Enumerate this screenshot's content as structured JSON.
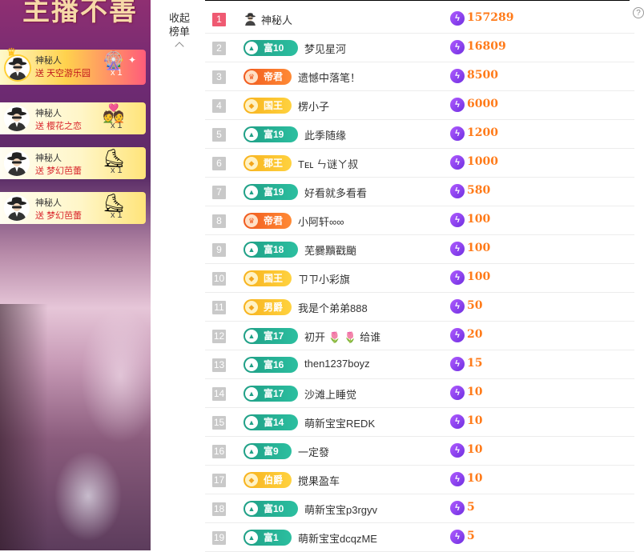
{
  "stream": {
    "title": "主播不善",
    "gifts": [
      {
        "name": "神秘人",
        "send_word": "送",
        "gift": "天空游乐园",
        "count": "x 1",
        "top": true
      },
      {
        "name": "神秘人",
        "send_word": "送",
        "gift": "樱花之恋",
        "count": "x 1",
        "top": false
      },
      {
        "name": "神秘人",
        "send_word": "送",
        "gift": "梦幻芭蕾",
        "count": "x 1",
        "top": false
      },
      {
        "name": "神秘人",
        "send_word": "送",
        "gift": "梦幻芭蕾",
        "count": "x 1",
        "top": false
      }
    ]
  },
  "collapse": {
    "line1": "收起",
    "line2": "榜单"
  },
  "help_icon": "?",
  "colors": {
    "accent": "#ff7b1a",
    "first_rank": "#ef5a72",
    "fu": "#1f9f86",
    "wang": "#f7b21e",
    "dijun": "#f05a1e",
    "coin": "#8a3ff0"
  },
  "ranking": [
    {
      "rank": "1",
      "badge": null,
      "badge_type": null,
      "name": "神秘人",
      "score": "157289"
    },
    {
      "rank": "2",
      "badge": "富10",
      "badge_type": "fu",
      "name": "梦见星河",
      "score": "16809"
    },
    {
      "rank": "3",
      "badge": "帝君",
      "badge_type": "dijun",
      "name": "遗憾中落笔！",
      "score": "8500"
    },
    {
      "rank": "4",
      "badge": "国王",
      "badge_type": "wang",
      "name": "楞小子",
      "score": "6000"
    },
    {
      "rank": "5",
      "badge": "富19",
      "badge_type": "fu",
      "name": "此季随缘",
      "score": "1200"
    },
    {
      "rank": "6",
      "badge": "郡王",
      "badge_type": "wang",
      "name": "Tᴇʟ ㄣ谜ㄚ叔",
      "score": "1000"
    },
    {
      "rank": "7",
      "badge": "富19",
      "badge_type": "fu",
      "name": "好看就多看看",
      "score": "580"
    },
    {
      "rank": "8",
      "badge": "帝君",
      "badge_type": "dijun",
      "name": "小阿轩∞∞",
      "score": "100"
    },
    {
      "rank": "9",
      "badge": "富18",
      "badge_type": "fu",
      "name": "芜爨黷戳颵",
      "score": "100"
    },
    {
      "rank": "10",
      "badge": "国王",
      "badge_type": "wang",
      "name": "ㄗㄗ小彩旗",
      "score": "100"
    },
    {
      "rank": "11",
      "badge": "男爵",
      "badge_type": "wang",
      "name": "我是个弟弟888",
      "score": "50"
    },
    {
      "rank": "12",
      "badge": "富17",
      "badge_type": "fu",
      "name": "初开 🌷 🌷 给谁",
      "score": "20"
    },
    {
      "rank": "13",
      "badge": "富16",
      "badge_type": "fu",
      "name": "then1237boyz",
      "score": "15"
    },
    {
      "rank": "14",
      "badge": "富17",
      "badge_type": "fu",
      "name": "沙滩上睡觉",
      "score": "10"
    },
    {
      "rank": "15",
      "badge": "富14",
      "badge_type": "fu",
      "name": "萌新宝宝REDK",
      "score": "10"
    },
    {
      "rank": "16",
      "badge": "富9",
      "badge_type": "fu",
      "name": "一定發",
      "score": "10"
    },
    {
      "rank": "17",
      "badge": "伯爵",
      "badge_type": "wang",
      "name": "搅果盈车",
      "score": "10"
    },
    {
      "rank": "18",
      "badge": "富10",
      "badge_type": "fu",
      "name": "萌新宝宝p3rgyv",
      "score": "5"
    },
    {
      "rank": "19",
      "badge": "富1",
      "badge_type": "fu",
      "name": "萌新宝宝dcqzME",
      "score": "5"
    }
  ]
}
